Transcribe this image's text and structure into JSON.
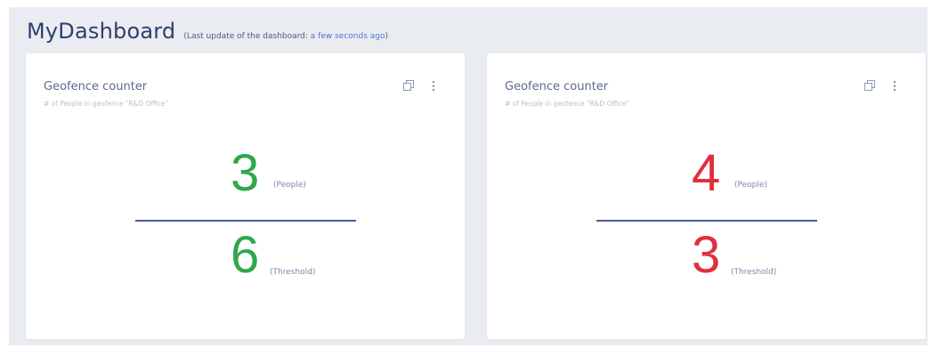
{
  "header": {
    "title": "MyDashboard",
    "subtitle_prefix": "(Last update of the dashboard: ",
    "subtitle_link": "a few seconds ago",
    "subtitle_suffix": ")"
  },
  "cards": [
    {
      "title": "Geofence counter",
      "subtitle": "# of People in geofence \"R&D Office\"",
      "people": {
        "value": "3",
        "unit": "(People)"
      },
      "threshold": {
        "value": "6",
        "unit": "(Threshold)"
      },
      "value_color": "#2ea84a",
      "icons": {
        "copy": "copy-icon",
        "more": "more-vertical-icon"
      }
    },
    {
      "title": "Geofence counter",
      "subtitle": "# of People in geofence \"R&D Office\"",
      "people": {
        "value": "4",
        "unit": "(People)"
      },
      "threshold": {
        "value": "3",
        "unit": "(Threshold)"
      },
      "value_color": "#e0303f",
      "icons": {
        "copy": "copy-icon",
        "more": "more-vertical-icon"
      }
    }
  ],
  "colors": {
    "background": "#e9ecf0",
    "card": "#ffffff",
    "title": "#2f3e6e",
    "link": "#5a6fd8",
    "divider": "#4b5a9b",
    "ok": "#2ea84a",
    "alert": "#e0303f"
  }
}
